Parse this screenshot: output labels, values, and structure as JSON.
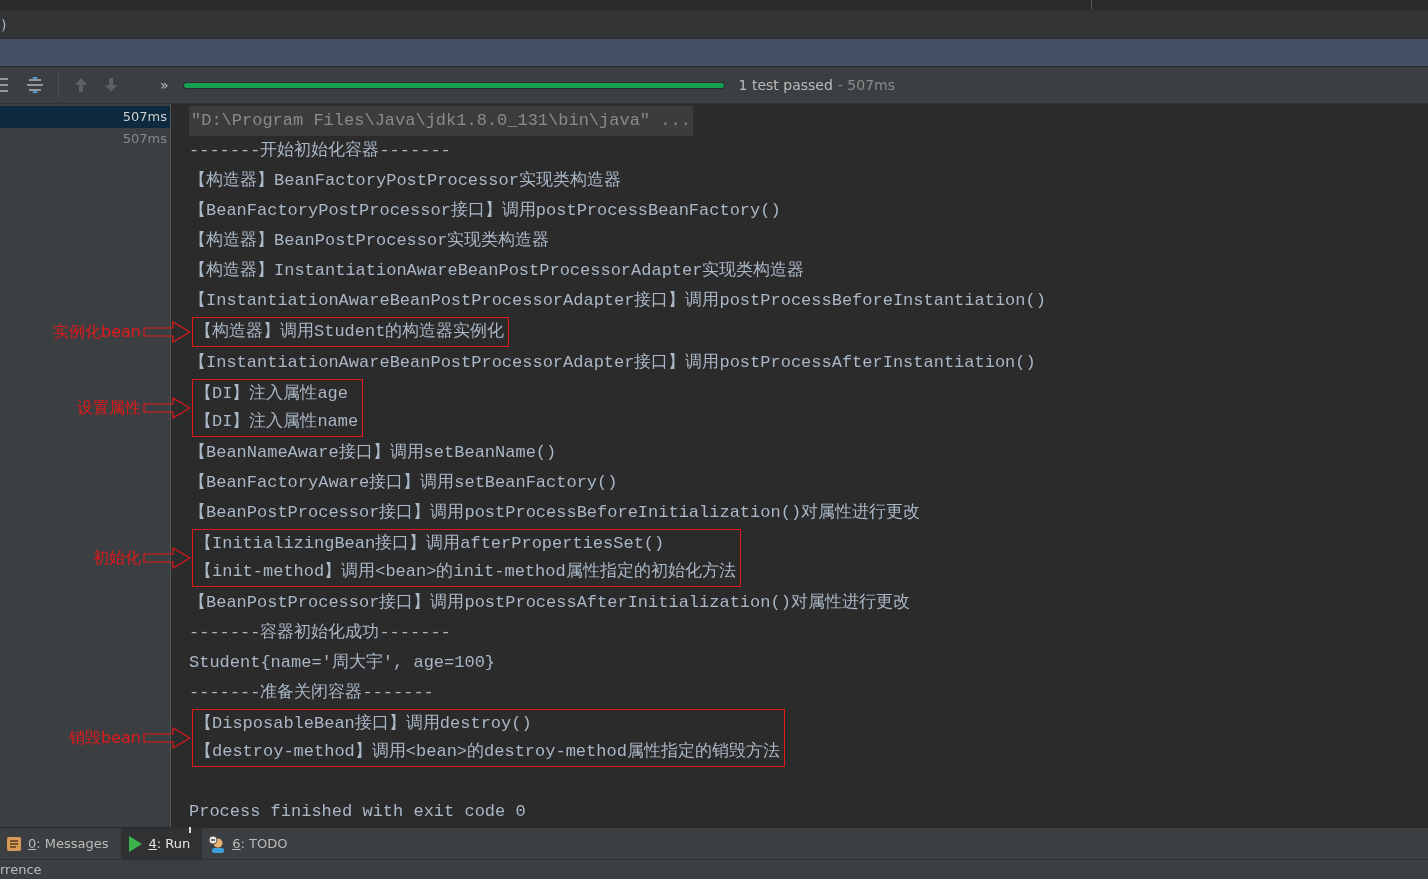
{
  "top_bar": {
    "text": ")"
  },
  "toolbar": {
    "progress": {
      "level": 1
    },
    "status": "1 test passed",
    "duration": "- 507ms",
    "overflow": "»"
  },
  "test_tree": [
    {
      "time": "507ms",
      "selected": true
    },
    {
      "time": "507ms",
      "selected": false
    }
  ],
  "console": [
    {
      "kind": "command",
      "text": "\"D:\\Program Files\\Java\\jdk1.8.0_131\\bin\\java\" ..."
    },
    {
      "kind": "line",
      "text": "-------开始初始化容器-------"
    },
    {
      "kind": "line",
      "text": "【构造器】BeanFactoryPostProcessor实现类构造器"
    },
    {
      "kind": "line",
      "text": "【BeanFactoryPostProcessor接口】调用postProcessBeanFactory()"
    },
    {
      "kind": "line",
      "text": "【构造器】BeanPostProcessor实现类构造器"
    },
    {
      "kind": "line",
      "text": "【构造器】InstantiationAwareBeanPostProcessorAdapter实现类构造器"
    },
    {
      "kind": "line",
      "text": "【InstantiationAwareBeanPostProcessorAdapter接口】调用postProcessBeforeInstantiation()"
    },
    {
      "kind": "group",
      "label": "实例化bean",
      "lines": [
        "【构造器】调用Student的构造器实例化"
      ]
    },
    {
      "kind": "line",
      "text": "【InstantiationAwareBeanPostProcessorAdapter接口】调用postProcessAfterInstantiation()"
    },
    {
      "kind": "group",
      "label": "设置属性",
      "lines": [
        "【DI】注入属性age",
        "【DI】注入属性name"
      ]
    },
    {
      "kind": "line",
      "text": "【BeanNameAware接口】调用setBeanName()"
    },
    {
      "kind": "line",
      "text": "【BeanFactoryAware接口】调用setBeanFactory()"
    },
    {
      "kind": "line",
      "text": "【BeanPostProcessor接口】调用postProcessBeforeInitialization()对属性进行更改"
    },
    {
      "kind": "group",
      "label": "初始化",
      "lines": [
        "【InitializingBean接口】调用afterPropertiesSet()",
        "【init-method】调用<bean>的init-method属性指定的初始化方法"
      ]
    },
    {
      "kind": "line",
      "text": "【BeanPostProcessor接口】调用postProcessAfterInitialization()对属性进行更改"
    },
    {
      "kind": "line",
      "text": "-------容器初始化成功-------"
    },
    {
      "kind": "line",
      "text": "Student{name='周大宇', age=100}"
    },
    {
      "kind": "line",
      "text": "-------准备关闭容器-------"
    },
    {
      "kind": "group",
      "label": "销毁bean",
      "lines": [
        "【DisposableBean接口】调用destroy()",
        "【destroy-method】调用<bean>的destroy-method属性指定的销毁方法"
      ]
    },
    {
      "kind": "exit",
      "text": "Process finished with exit code 0"
    }
  ],
  "tool_tabs": [
    {
      "key": "0",
      "label": ": Messages",
      "kind": "messages",
      "selected": false
    },
    {
      "key": "4",
      "label": ": Run",
      "kind": "run",
      "selected": true
    },
    {
      "key": "6",
      "label": ": TODO",
      "kind": "todo",
      "selected": false
    }
  ],
  "status_bar": {
    "text": "rrence"
  }
}
